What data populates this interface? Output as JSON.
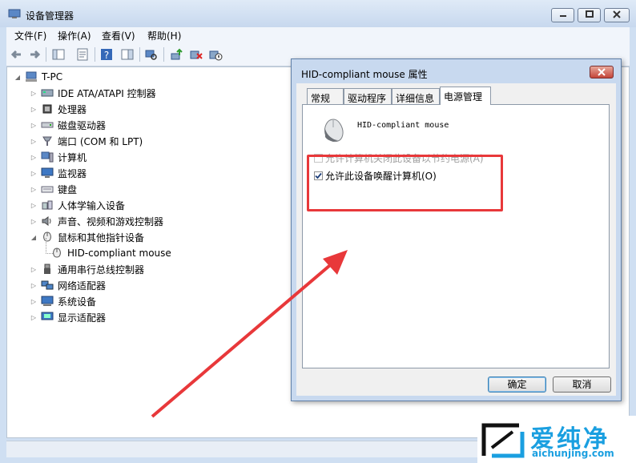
{
  "window": {
    "title": "设备管理器",
    "controls": {
      "minimize": "minimize",
      "maximize": "maximize",
      "close": "close"
    }
  },
  "menu": [
    "文件(F)",
    "操作(A)",
    "查看(V)",
    "帮助(H)"
  ],
  "toolbar_icons": [
    "back-icon",
    "forward-icon",
    "console-tree-icon",
    "properties-icon",
    "help-icon",
    "action-pane-icon",
    "scan-hardware-icon",
    "update-driver-icon",
    "uninstall-icon",
    "disable-icon"
  ],
  "tree": {
    "root": "T-PC",
    "items": [
      {
        "label": "IDE ATA/ATAPI 控制器",
        "icon": "ide-controller-icon"
      },
      {
        "label": "处理器",
        "icon": "processor-icon"
      },
      {
        "label": "磁盘驱动器",
        "icon": "disk-drive-icon"
      },
      {
        "label": "端口 (COM 和 LPT)",
        "icon": "port-icon"
      },
      {
        "label": "计算机",
        "icon": "computer-icon"
      },
      {
        "label": "监视器",
        "icon": "monitor-icon"
      },
      {
        "label": "键盘",
        "icon": "keyboard-icon"
      },
      {
        "label": "人体学输入设备",
        "icon": "hid-icon"
      },
      {
        "label": "声音、视频和游戏控制器",
        "icon": "sound-icon"
      },
      {
        "label": "鼠标和其他指针设备",
        "icon": "mouse-icon",
        "expanded": true
      },
      {
        "label": "HID-compliant mouse",
        "icon": "mouse-icon",
        "child": true
      },
      {
        "label": "通用串行总线控制器",
        "icon": "usb-icon"
      },
      {
        "label": "网络适配器",
        "icon": "network-icon"
      },
      {
        "label": "系统设备",
        "icon": "system-icon"
      },
      {
        "label": "显示适配器",
        "icon": "display-icon"
      }
    ]
  },
  "dialog": {
    "title": "HID-compliant mouse 属性",
    "tabs": [
      "常规",
      "驱动程序",
      "详细信息",
      "电源管理"
    ],
    "active_tab": "电源管理",
    "device_name": "HID-compliant mouse",
    "options": [
      {
        "label": "允许计算机关闭此设备以节约电源(A)",
        "checked": false,
        "enabled": false
      },
      {
        "label": "允许此设备唤醒计算机(O)",
        "checked": true,
        "enabled": true
      }
    ],
    "ok_label": "确定",
    "cancel_label": "取消"
  },
  "watermark": {
    "brand": "爱纯净",
    "url": "aichunjing.com"
  },
  "colors": {
    "highlight": "#e8383a",
    "watermark": "#1a9fe0"
  }
}
